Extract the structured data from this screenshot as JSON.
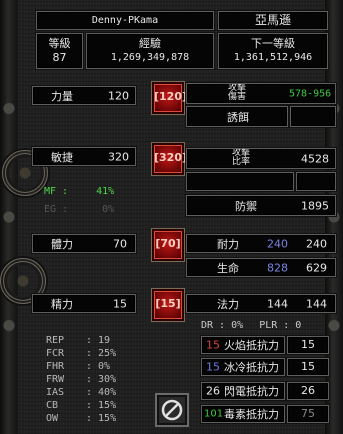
{
  "header": {
    "name": "Denny-PKama",
    "class": "亞馬遜",
    "level_label": "等級",
    "level": "87",
    "exp_label": "經驗",
    "exp": "1,269,349,878",
    "next_label": "下一等級",
    "next": "1,361,512,946"
  },
  "attrs": {
    "str_label": "力量",
    "str": "120",
    "str_btn": "120",
    "dex_label": "敏捷",
    "dex": "320",
    "dex_btn": "320",
    "vit_label": "體力",
    "vit": "70",
    "vit_btn": "70",
    "ene_label": "精力",
    "ene": "15",
    "ene_btn": "15"
  },
  "combat": {
    "damage_label_top": "攻擊",
    "damage_label_bottom": "傷害",
    "damage": "578-956",
    "damage_color": "#3cc83c",
    "skill_label": "誘餌",
    "rating_label_top": "攻擊",
    "rating_label_bottom": "比率",
    "rating": "4528",
    "defense_label": "防禦",
    "defense": "1895"
  },
  "mf": {
    "mf_label": "MF :",
    "mf": "41%",
    "mf_color": "#4cd64c",
    "eg_label": "EG :",
    "eg": "0%"
  },
  "vitals": {
    "stamina_label": "耐力",
    "stamina_cur": "240",
    "stamina_max": "240",
    "life_label": "生命",
    "life_cur": "828",
    "life_max": "629",
    "mana_label": "法力",
    "mana_cur": "144",
    "mana_max": "144",
    "cur_color": "#7a84e0"
  },
  "misc": {
    "dr": "DR :  0%",
    "plr": "PLR :  0"
  },
  "stats": [
    {
      "name": "REP",
      "value": ": 19"
    },
    {
      "name": "FCR",
      "value": ": 25%"
    },
    {
      "name": "FHR",
      "value": ": 0%"
    },
    {
      "name": "FRW",
      "value": ": 30%"
    },
    {
      "name": "IAS",
      "value": ": 40%"
    },
    {
      "name": "CB",
      "value": ": 15%"
    },
    {
      "name": "OW",
      "value": ": 15%"
    }
  ],
  "resists": {
    "fire_num": "15",
    "fire_label": "火焰抵抗力",
    "fire": "15",
    "fire_color": "#d84040",
    "cold_num": "15",
    "cold_label": "冰冷抵抗力",
    "cold": "15",
    "cold_color": "#6a7ae0",
    "light_num": "26",
    "light_label": "閃電抵抗力",
    "light": "26",
    "light_color": "#e0e0e0",
    "poison_num": "101",
    "poison_label": "毒素抵抗力",
    "poison": "75",
    "poison_color": "#3cc83c"
  },
  "close_icon": "no-entry-icon",
  "icons": [
    "str-add-icon",
    "dex-add-icon",
    "vit-add-icon",
    "ene-add-icon"
  ]
}
